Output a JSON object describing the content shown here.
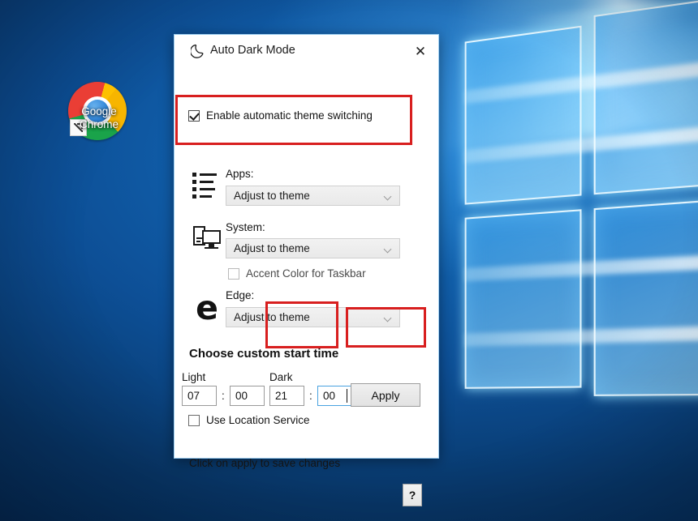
{
  "desktop": {
    "icons": [
      {
        "name": "Google Chrome",
        "label_line1": "Google",
        "label_line2": "Chrome",
        "icon": "chrome-icon"
      }
    ]
  },
  "dialog": {
    "title": "Auto Dark Mode",
    "title_icon": "moon-icon",
    "close_label": "✕",
    "enable_checkbox": {
      "label": "Enable automatic theme switching",
      "checked": true
    },
    "sections": [
      {
        "icon": "apps-list-icon",
        "label": "Apps:",
        "dropdown_value": "Adjust to theme",
        "highlighted": true
      },
      {
        "icon": "system-monitor-icon",
        "label": "System:",
        "dropdown_value": "Adjust to theme",
        "checkbox_label": "Accent Color for Taskbar",
        "checkbox_checked": false,
        "highlighted": false
      },
      {
        "icon": "edge-logo-icon",
        "label": "Edge:",
        "dropdown_value": "Adjust to theme",
        "highlighted": false
      }
    ],
    "custom_time": {
      "heading": "Choose custom start time",
      "light": {
        "label": "Light",
        "hours": "07",
        "separator": ":",
        "minutes": "00"
      },
      "dark": {
        "label": "Dark",
        "hours": "21",
        "separator": ":",
        "minutes": "00",
        "highlighted": true,
        "minutes_focused": true
      }
    },
    "apply_button": "Apply",
    "location_checkbox": {
      "label": "Use Location Service",
      "checked": false
    },
    "hint": "Click on apply to save changes",
    "help_button": "?"
  },
  "colors": {
    "annotation_red": "#d81f1f",
    "window_border_blue": "#9fd0f2",
    "desktop_blue": "#0d4f96",
    "focus_blue": "#4aa3e0"
  }
}
